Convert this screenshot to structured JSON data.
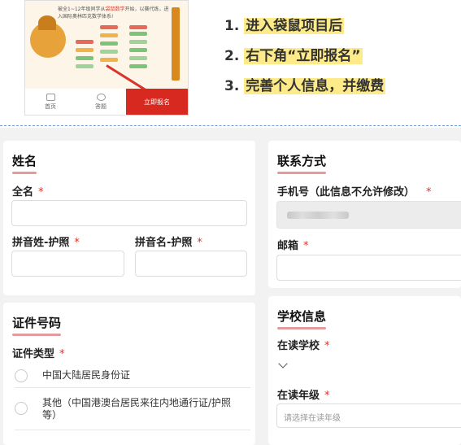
{
  "promo": {
    "headline_prefix": "被全1~12年级同学从",
    "headline_highlight": "袋鼠数学",
    "headline_suffix": "开始，以赛代练，进入国际奥林匹克数学体系!",
    "nav_home": "首页",
    "nav_ring": "答题",
    "nav_signup": "立即报名"
  },
  "steps": [
    {
      "num": "1.",
      "text": "进入袋鼠项目后"
    },
    {
      "num": "2.",
      "text": "右下角“立即报名”"
    },
    {
      "num": "3.",
      "text": "完善个人信息，并缴费"
    }
  ],
  "colors": {
    "accent_red": "#d7291f",
    "step_highlight": "#fdeb8a",
    "title_underline": "#e39a9a",
    "divider": "#6f9bd6"
  },
  "name_section": {
    "title": "姓名",
    "full_name_label": "全名",
    "required_mark": "*",
    "pinyin_last_label": "拼音姓-护照",
    "pinyin_first_label": "拼音名-护照"
  },
  "id_section": {
    "title": "证件号码",
    "type_label": "证件类型",
    "options": [
      "中国大陆居民身份证",
      "其他（中国港澳台居民来往内地通行证/护照等）"
    ]
  },
  "contact_section": {
    "title": "联系方式",
    "phone_label": "手机号（此信息不允许修改）",
    "email_label": "邮箱"
  },
  "school_section": {
    "title": "学校信息",
    "school_label": "在读学校",
    "grade_label": "在读年级",
    "grade_placeholder": "请选择在读年级"
  }
}
